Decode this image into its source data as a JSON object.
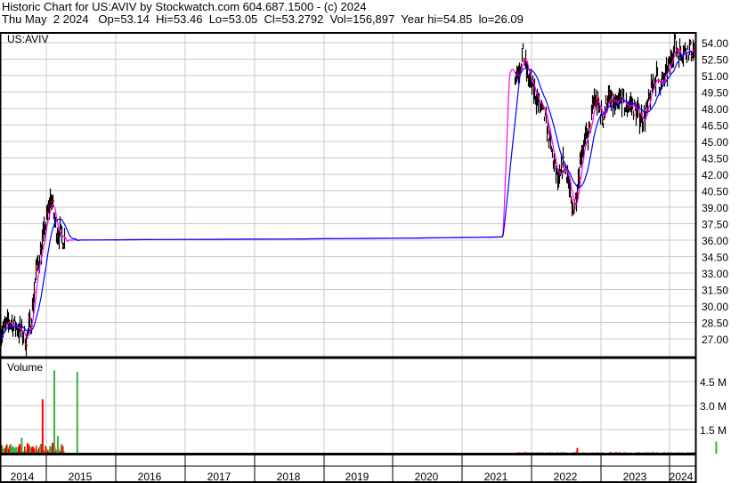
{
  "header": {
    "line1": "Historic Chart for US:AVIV by Stockwatch.com 604.687.1500 - (c) 2024",
    "line2": "Thu May  2 2024   Op=53.14  Hi=53.46  Lo=53.05  Cl=53.2792  Vol=156,897  Year hi=54.85  lo=26.09"
  },
  "chart_data": {
    "type": "line",
    "symbol": "US:AVIV",
    "volume_label": "Volume",
    "price_ticks": [
      "54.00",
      "52.50",
      "51.00",
      "49.50",
      "48.00",
      "46.50",
      "45.00",
      "43.50",
      "42.00",
      "40.50",
      "39.00",
      "37.50",
      "36.00",
      "34.50",
      "33.00",
      "31.50",
      "30.00",
      "28.50",
      "27.00"
    ],
    "ylim": [
      27,
      54
    ],
    "volume_ticks": [
      "4.5 M",
      "3.0 M",
      "1.5 M"
    ],
    "x_labels": [
      "2014",
      "2015",
      "2016",
      "2017",
      "2018",
      "2019",
      "2020",
      "2021",
      "2022",
      "2023",
      "2024"
    ],
    "xlim": [
      2014.0,
      2024.35
    ],
    "colors": {
      "price": "#000000",
      "ma_short": "#ff00ff",
      "ma_long": "#0000ff",
      "vol_up": "#3cb043",
      "vol_down": "#ff0000"
    },
    "close_points": [
      [
        2014.0,
        27.5
      ],
      [
        2014.13,
        28.5
      ],
      [
        2014.26,
        28
      ],
      [
        2014.38,
        27
      ],
      [
        2014.45,
        29
      ],
      [
        2014.51,
        33
      ],
      [
        2014.58,
        35
      ],
      [
        2014.64,
        37
      ],
      [
        2014.73,
        40
      ],
      [
        2014.8,
        37
      ],
      [
        2014.87,
        36.5
      ],
      [
        2014.92,
        36
      ],
      [
        2016.0,
        36.05
      ],
      [
        2018.0,
        36.1
      ],
      [
        2020.0,
        36.2
      ],
      [
        2021.24,
        36.3
      ],
      [
        2021.26,
        50
      ],
      [
        2021.33,
        52
      ],
      [
        2021.4,
        51
      ],
      [
        2021.46,
        51.5
      ],
      [
        2021.53,
        53
      ],
      [
        2021.59,
        51
      ],
      [
        2021.65,
        50
      ],
      [
        2021.72,
        49
      ],
      [
        2021.78,
        48
      ],
      [
        2021.85,
        47
      ],
      [
        2021.91,
        45
      ],
      [
        2021.97,
        43
      ],
      [
        2022.04,
        41
      ],
      [
        2022.1,
        43
      ],
      [
        2022.17,
        42
      ],
      [
        2022.23,
        38.5
      ],
      [
        2022.29,
        40
      ],
      [
        2022.36,
        44
      ],
      [
        2022.42,
        45
      ],
      [
        2022.49,
        46
      ],
      [
        2022.55,
        49
      ],
      [
        2022.62,
        48
      ],
      [
        2022.68,
        47
      ],
      [
        2022.74,
        49
      ],
      [
        2022.81,
        48.5
      ],
      [
        2022.87,
        48
      ],
      [
        2022.94,
        49
      ],
      [
        2023.0,
        48
      ],
      [
        2023.06,
        48.5
      ],
      [
        2023.13,
        48
      ],
      [
        2023.19,
        47.5
      ],
      [
        2023.26,
        47
      ],
      [
        2023.32,
        48
      ],
      [
        2023.38,
        50
      ],
      [
        2023.45,
        51
      ],
      [
        2023.51,
        50
      ],
      [
        2023.58,
        51
      ],
      [
        2023.64,
        52
      ],
      [
        2023.71,
        54
      ],
      [
        2023.77,
        53
      ],
      [
        2023.83,
        53.3
      ]
    ],
    "volume_spikes_m": [
      [
        2014.6,
        3.4,
        "down"
      ],
      [
        2014.77,
        5.2,
        "up"
      ],
      [
        2015.1,
        5.1,
        "up"
      ],
      [
        2014.3,
        1.0,
        "up"
      ],
      [
        2014.82,
        1.1,
        "up"
      ],
      [
        2022.3,
        0.35,
        "down"
      ],
      [
        2024.3,
        0.75,
        "up"
      ]
    ]
  }
}
